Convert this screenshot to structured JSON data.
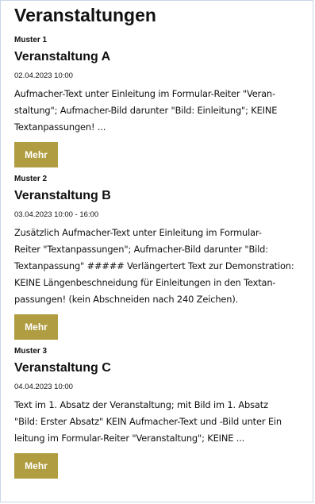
{
  "page": {
    "title": "Veranstaltungen"
  },
  "events": [
    {
      "kicker": "Muster 1",
      "title": "Veranstaltung A",
      "date": "02.04.2023 10:00",
      "teaser_lines": [
        "Aufmacher-Text unter Einleitung im Formular-Reiter \"Veran-",
        "staltung\"; Aufmacher-Bild darunter \"Bild: Einleitung\"; KEINE",
        "Textanpassungen! ..."
      ],
      "more_label": "Mehr"
    },
    {
      "kicker": "Muster 2",
      "title": "Veranstaltung B",
      "date": "03.04.2023 10:00 - 16:00",
      "teaser_lines": [
        "Zusätzlich Aufmacher-Text unter Einleitung im Formular-",
        "Reiter \"Textanpassungen\"; Aufmacher-Bild darunter \"Bild:",
        "Textanpassung\" ##### Verlängertert Text zur Demonstration:",
        "KEINE Längenbeschneidung für Einleitungen in den Textan-",
        "passungen! (kein Abschneiden nach 240 Zeichen)."
      ],
      "more_label": "Mehr"
    },
    {
      "kicker": "Muster 3",
      "title": "Veranstaltung C",
      "date": "04.04.2023 10:00",
      "teaser_lines": [
        "Text im 1. Absatz der Veranstaltung; mit Bild im 1. Absatz",
        "\"Bild: Erster Absatz\" KEIN Aufmacher-Text und -Bild unter Ein",
        "leitung im Formular-Reiter \"Veranstaltung\"; KEINE ..."
      ],
      "more_label": "Mehr"
    }
  ],
  "colors": {
    "button_bg": "#b09d41",
    "button_text": "#ffffff",
    "frame_border": "#c8d6e8"
  }
}
